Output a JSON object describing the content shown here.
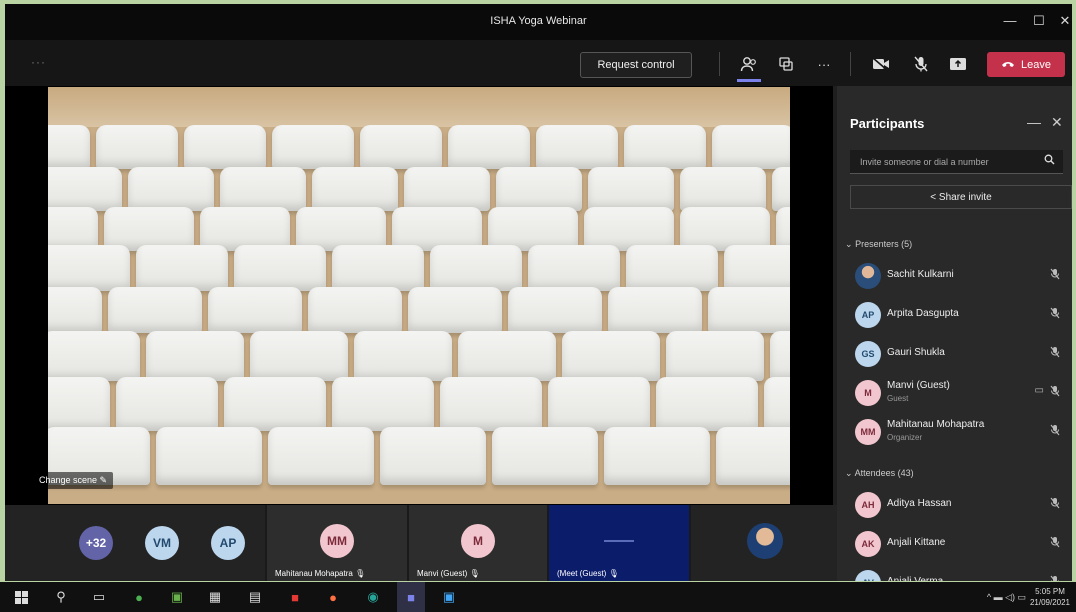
{
  "window": {
    "title": "ISHA Yoga Webinar",
    "controls": {
      "minimize": "—",
      "maximize": "☐",
      "close": "✕"
    }
  },
  "toolbar": {
    "more_left": "···",
    "request_control": "Request control",
    "more": "···",
    "leave_label": "Leave",
    "accent_color": "#7b83eb",
    "leave_color": "#c4314b"
  },
  "stage": {
    "change_scene": "Change scene ✎"
  },
  "participants_panel": {
    "title": "Participants",
    "invite_placeholder": "Invite someone or dial a number",
    "share_invite": "Share invite",
    "presenters_header": "Presenters (5)",
    "presenters": [
      {
        "name": "Sachit Kulkarni",
        "role": "",
        "initials": "",
        "avatar": "photo"
      },
      {
        "name": "Arpita Dasgupta",
        "role": "",
        "initials": "AP",
        "avatar": "blue"
      },
      {
        "name": "Gauri Shukla",
        "role": "",
        "initials": "GS",
        "avatar": "blue"
      },
      {
        "name": "Manvi (Guest)",
        "role": "Guest",
        "initials": "M",
        "avatar": "pink"
      },
      {
        "name": "Mahitanau Mohapatra",
        "role": "Organizer",
        "initials": "MM",
        "avatar": "pink"
      }
    ],
    "attendees_header": "Attendees (43)",
    "attendees": [
      {
        "name": "Aditya Hassan",
        "role": "",
        "initials": "AH",
        "avatar": "pink"
      },
      {
        "name": "Anjali Kittane",
        "role": "",
        "initials": "AK",
        "avatar": "pink"
      },
      {
        "name": "Anjali Verma",
        "role": "",
        "initials": "AV",
        "avatar": "blue"
      }
    ]
  },
  "tiles": [
    {
      "initials": "+32",
      "label": ""
    },
    {
      "initials": "VM",
      "label": ""
    },
    {
      "initials": "AP",
      "label": ""
    },
    {
      "initials": "MM",
      "label": "Mahitanau Mohapatra"
    },
    {
      "initials": "M",
      "label": "Manvi (Guest)"
    },
    {
      "initials": "",
      "label": "(Meet (Guest)"
    },
    {
      "initials": "",
      "label": ""
    }
  ],
  "taskbar": {
    "tray_text": "^ ▬ ◁) ▭",
    "time": "5:05 PM",
    "date": "21/09/2021"
  }
}
